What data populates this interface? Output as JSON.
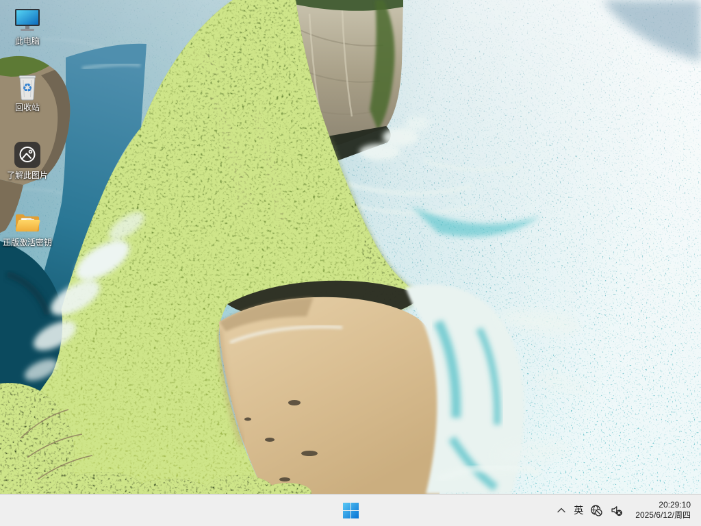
{
  "desktop": {
    "icons": [
      {
        "name": "this-pc",
        "label": "此电脑"
      },
      {
        "name": "recycle-bin",
        "label": "回收站"
      },
      {
        "name": "learn-about-this-picture",
        "label": "了解此图片"
      },
      {
        "name": "genuine-activation-key-folder",
        "label": "正版激活密钥"
      }
    ]
  },
  "taskbar": {
    "start_icon": "windows-logo",
    "tray": {
      "hidden_icons_icon": "chevron-up",
      "ime_label": "英",
      "network_icon": "globe-no-internet",
      "volume_icon": "speaker-muted",
      "time": "20:29:10",
      "date": "2025/6/12/周四"
    }
  },
  "colors": {
    "taskbar_bg": "#efefef",
    "taskbar_border": "#c8c8c8",
    "windows_blue_light": "#5ac8f5",
    "windows_blue_dark": "#0873d4",
    "desktop_label_text": "#ffffff",
    "tray_text": "#1a1a1a",
    "sea_turquoise": "#2fb0bb",
    "sand": "#d9be92",
    "cliff_green": "#6b8d37"
  }
}
